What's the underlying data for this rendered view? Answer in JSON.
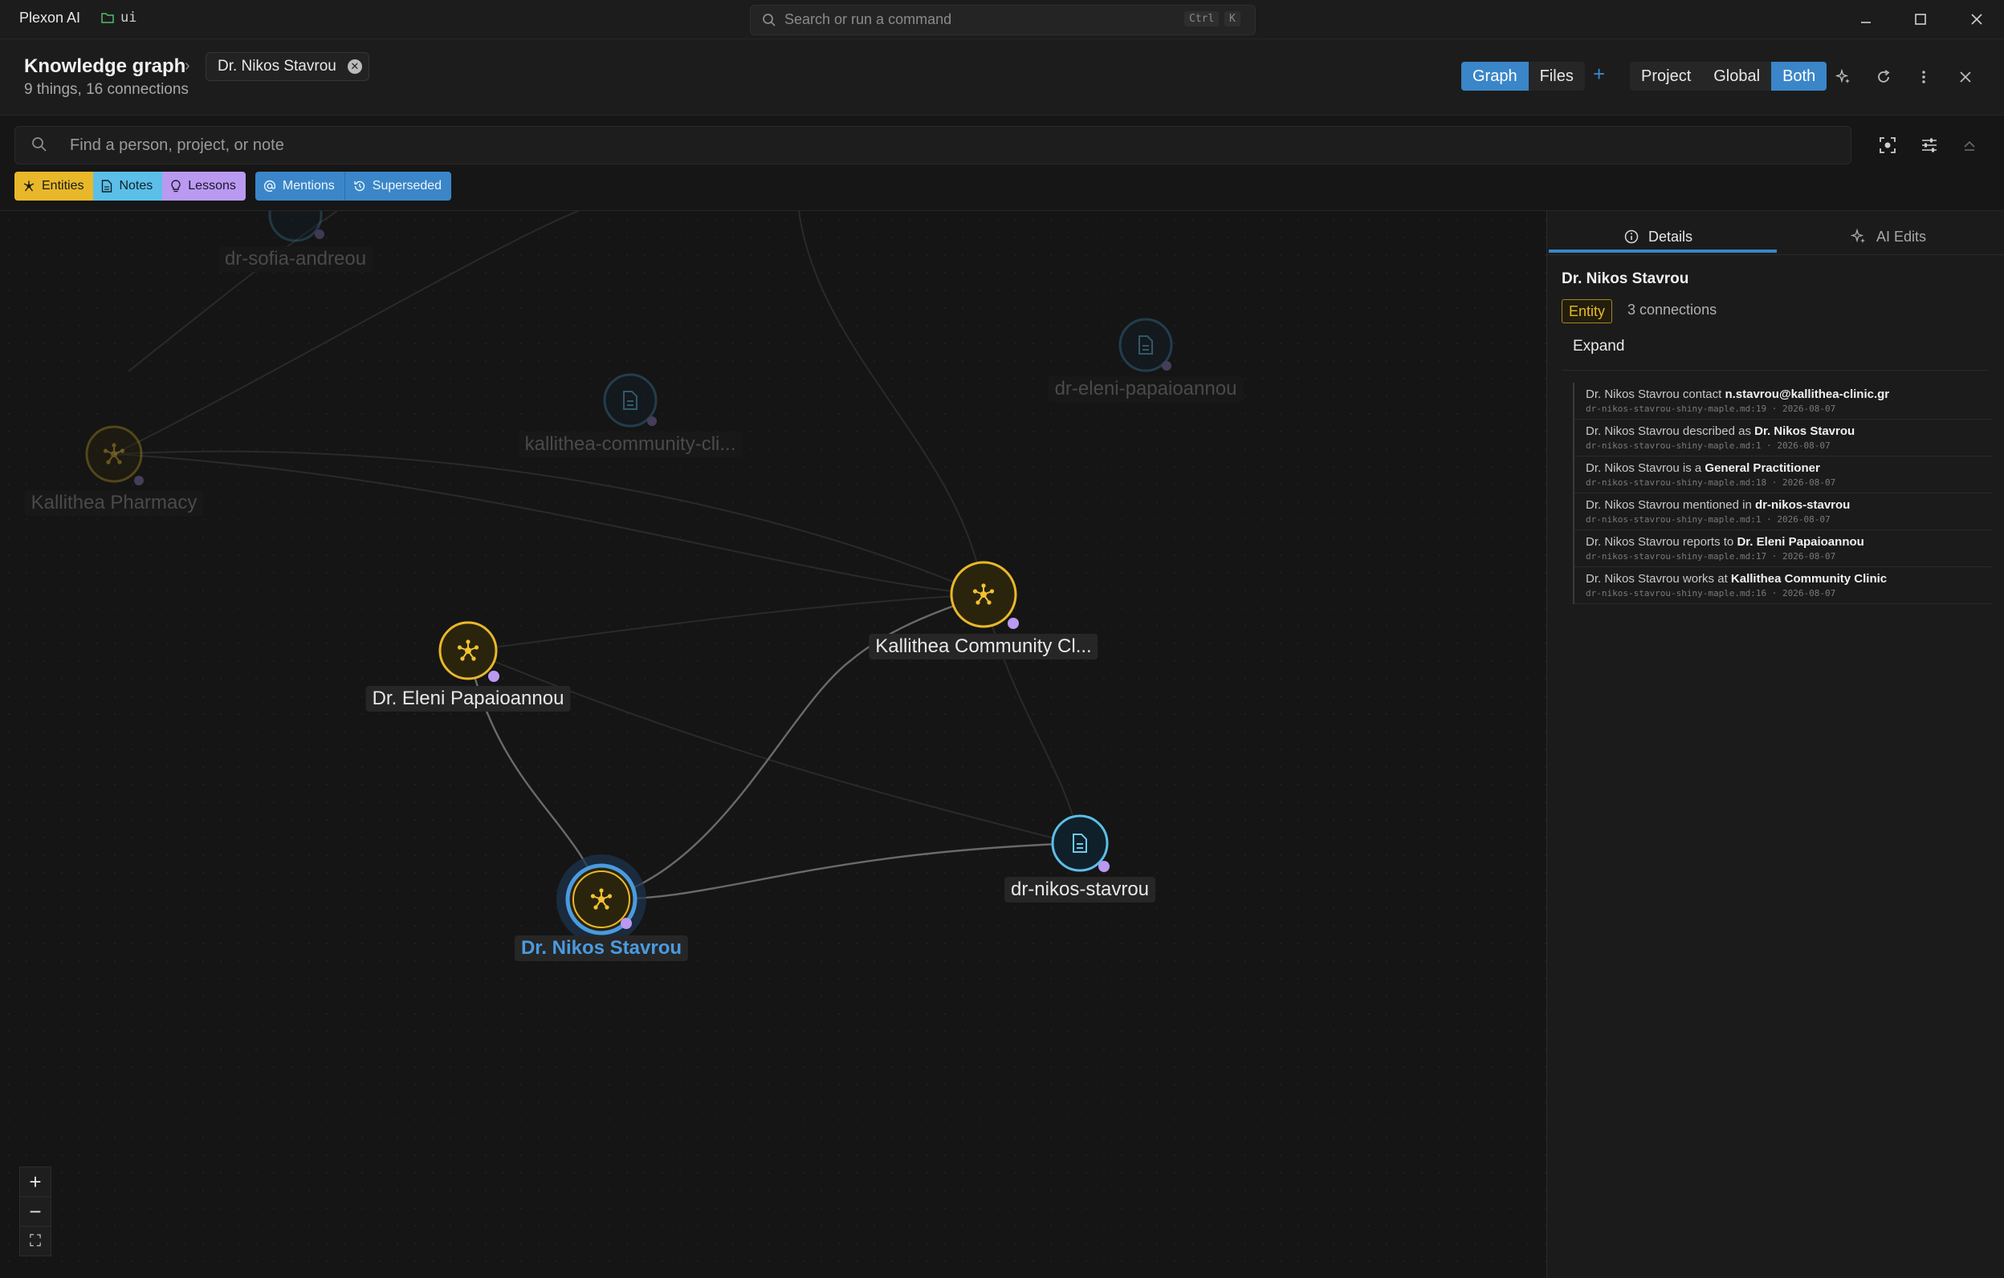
{
  "titlebar": {
    "app_name": "Plexon AI",
    "workspace": "ui",
    "command_placeholder": "Search or run a command",
    "shortcut_keys": [
      "Ctrl",
      "K"
    ]
  },
  "header": {
    "title": "Knowledge graph",
    "breadcrumb_entity": "Dr. Nikos Stavrou",
    "subtitle": "9 things, 16 connections",
    "view_tabs": [
      "Graph",
      "Files"
    ],
    "active_view": "Graph",
    "add_label": "+",
    "scope_tabs": [
      "Project",
      "Global",
      "Both"
    ],
    "active_scope": "Both"
  },
  "search": {
    "placeholder": "Find a person, project, or note"
  },
  "filters": {
    "entities": "Entities",
    "notes": "Notes",
    "lessons": "Lessons",
    "mentions": "Mentions",
    "superseded": "Superseded"
  },
  "colors": {
    "entity": "#e8b82a",
    "note": "#5bbfe8",
    "lesson": "#b99af0",
    "accent": "#3a86c8",
    "selected": "#4a9be0"
  },
  "graph": {
    "nodes": [
      {
        "id": "n1",
        "label": "dr-sofia-andreou",
        "kind": "note",
        "faded": true
      },
      {
        "id": "n2",
        "label": "dr-eleni-papaioannou",
        "kind": "note",
        "faded": true
      },
      {
        "id": "n3",
        "label": "kallithea-community-cli...",
        "kind": "note",
        "faded": true
      },
      {
        "id": "n4",
        "label": "Kallithea Pharmacy",
        "kind": "entity",
        "faded": true
      },
      {
        "id": "n5",
        "label": "Kallithea Community Cl...",
        "kind": "entity",
        "faded": false
      },
      {
        "id": "n6",
        "label": "Dr. Eleni Papaioannou",
        "kind": "entity",
        "faded": false
      },
      {
        "id": "n7",
        "label": "dr-nikos-stavrou",
        "kind": "note",
        "faded": false
      },
      {
        "id": "n8",
        "label": "Dr. Nikos Stavrou",
        "kind": "entity",
        "faded": false,
        "selected": true
      }
    ]
  },
  "zoom_controls": {
    "zoom_in": "+",
    "zoom_out": "−",
    "fit": "⛶"
  },
  "panel": {
    "tabs": [
      "Details",
      "AI Edits"
    ],
    "active_tab": "Details",
    "entity_name": "Dr. Nikos Stavrou",
    "badge": "Entity",
    "connections": "3 connections",
    "expand_label": "Expand",
    "facts": [
      {
        "subject": "Dr. Nikos Stavrou",
        "predicate": "contact",
        "object": "n.stavrou@kallithea-clinic.gr",
        "meta": "dr-nikos-stavrou-shiny-maple.md:19 · 2026-08-07"
      },
      {
        "subject": "Dr. Nikos Stavrou",
        "predicate": "described as",
        "object": "Dr. Nikos Stavrou",
        "meta": "dr-nikos-stavrou-shiny-maple.md:1 · 2026-08-07"
      },
      {
        "subject": "Dr. Nikos Stavrou",
        "predicate": "is a",
        "object": "General Practitioner",
        "meta": "dr-nikos-stavrou-shiny-maple.md:18 · 2026-08-07"
      },
      {
        "subject": "Dr. Nikos Stavrou",
        "predicate": "mentioned in",
        "object": "dr-nikos-stavrou",
        "meta": "dr-nikos-stavrou-shiny-maple.md:1 · 2026-08-07"
      },
      {
        "subject": "Dr. Nikos Stavrou",
        "predicate": "reports to",
        "object": "Dr. Eleni Papaioannou",
        "meta": "dr-nikos-stavrou-shiny-maple.md:17 · 2026-08-07"
      },
      {
        "subject": "Dr. Nikos Stavrou",
        "predicate": "works at",
        "object": "Kallithea Community Clinic",
        "meta": "dr-nikos-stavrou-shiny-maple.md:16 · 2026-08-07"
      }
    ]
  }
}
